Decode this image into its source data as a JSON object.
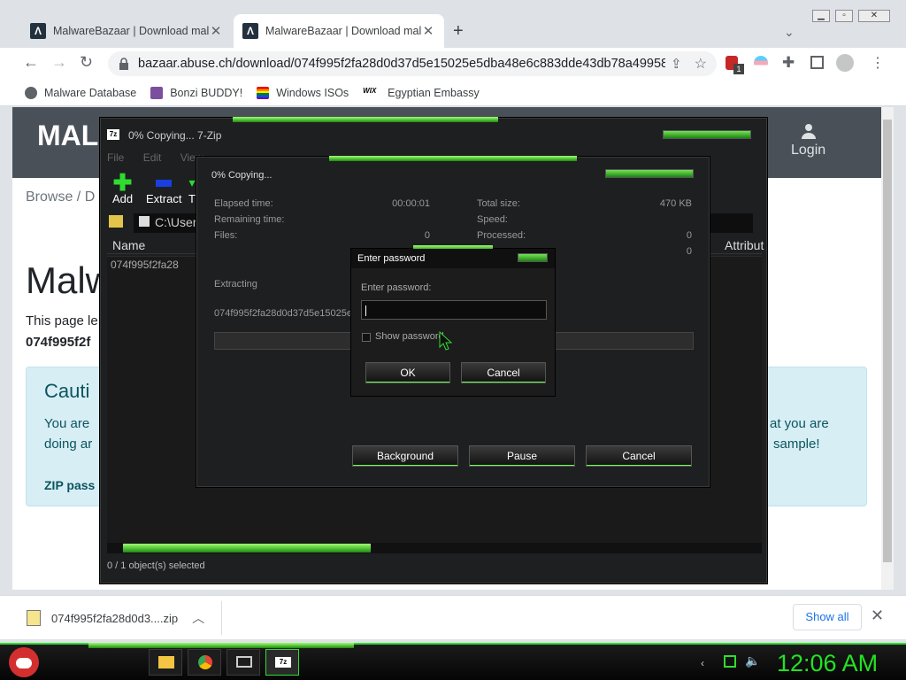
{
  "browser": {
    "tabs": [
      {
        "favicon": "malwarebazaar-logo-icon",
        "title": "MalwareBazaar | Download malw"
      },
      {
        "favicon": "malwarebazaar-logo-icon",
        "title": "MalwareBazaar | Download malw"
      }
    ],
    "new_tab": "+",
    "url": "bazaar.abuse.ch/download/074f995f2fa28d0d37d5e15025e5dba48e6c883dde43db78a49958...",
    "extension_badge": "1",
    "bookmarks": [
      {
        "icon": "globe-icon",
        "label": "Malware Database"
      },
      {
        "icon": "bonzi-icon",
        "label": "Bonzi BUDDY!"
      },
      {
        "icon": "rainbow-flag-icon",
        "label": "Windows ISOs"
      },
      {
        "icon": "wix-icon",
        "label": "Egyptian Embassy"
      }
    ]
  },
  "page": {
    "brand": "MAL",
    "login": "Login",
    "breadcrumb": "Browse  /  D",
    "title": "Malw",
    "description": "This page le",
    "hash_fragment": "074f995f2f",
    "caution": {
      "title": "Cauti",
      "line1_left": "You are",
      "line1_right": "at you are",
      "line2_left": "doing ar",
      "line2_right": "sample!",
      "zip_label": "ZIP pass"
    }
  },
  "download_bar": {
    "filename": "074f995f2fa28d0d3....zip",
    "show_all": "Show all"
  },
  "taskbar": {
    "clock": "12:06 AM",
    "apps": [
      "folder-icon",
      "chrome-icon",
      "computer-icon",
      "7zip-icon"
    ]
  },
  "zip_main": {
    "title": "0% Copying... 7-Zip",
    "menu": [
      "File",
      "Edit",
      "View"
    ],
    "tools": [
      "Add",
      "Extract",
      "T"
    ],
    "path": "C:\\User",
    "columns": [
      "Name",
      "Attribut"
    ],
    "file_row": "074f995f2fa28",
    "status": "0 / 1 object(s) selected"
  },
  "progress": {
    "title": "0% Copying...",
    "elapsed_label": "Elapsed time:",
    "elapsed_value": "00:00:01",
    "remaining_label": "Remaining time:",
    "files_label": "Files:",
    "files_value": "0",
    "total_label": "Total size:",
    "total_value": "470 KB",
    "speed_label": "Speed:",
    "processed_label": "Processed:",
    "processed_value": "0",
    "extra_value": "0",
    "extracting": "Extracting",
    "extract_file": "074f995f2fa28d0d37d5e15025e",
    "percent_complete": 0,
    "buttons": {
      "background": "Background",
      "pause": "Pause",
      "cancel": "Cancel"
    }
  },
  "password_dialog": {
    "title": "Enter password",
    "prompt": "Enter password:",
    "value": "",
    "show_password": "Show password",
    "ok": "OK",
    "cancel": "Cancel"
  },
  "colors": {
    "accent_green": "#22e322",
    "chrome_bg": "#dee1e6",
    "page_header": "#495058",
    "caution_bg": "#d7eef4"
  }
}
